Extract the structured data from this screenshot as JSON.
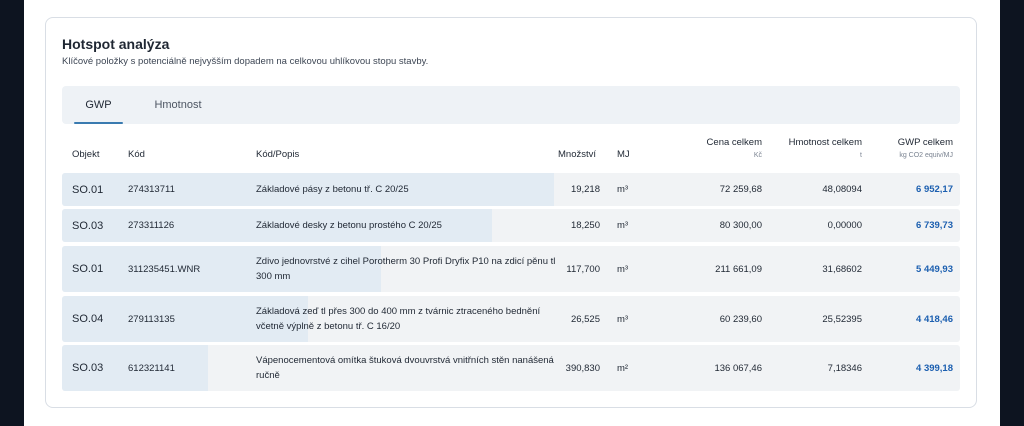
{
  "header": {
    "title": "Hotspot analýza",
    "subtitle": "Klíčové položky s potenciálně nejvyšším dopadem na celkovou uhlíkovou stopu stavby."
  },
  "tabs": [
    {
      "label": "GWP",
      "active": true
    },
    {
      "label": "Hmotnost",
      "active": false
    }
  ],
  "columns": {
    "objekt": "Objekt",
    "kod": "Kód",
    "popis": "Kód/Popis",
    "mnozstvi": "Množství",
    "mj": "MJ",
    "cena": "Cena celkem",
    "cena_unit": "Kč",
    "hmotnost": "Hmotnost celkem",
    "hmotnost_unit": "t",
    "gwp": "GWP celkem",
    "gwp_unit": "kg CO2 equiv/MJ"
  },
  "colors": {
    "accent": "#1c5fb0",
    "bar": "#e2ebf3"
  },
  "rows": [
    {
      "objekt": "SO.01",
      "kod": "274313711",
      "popis": "Základové pásy z betonu tř. C 20/25",
      "mnozstvi": "19,218",
      "mj": "m³",
      "cena": "72 259,68",
      "hmotnost": "48,08094",
      "gwp": "6 952,17",
      "share": 1.0
    },
    {
      "objekt": "SO.03",
      "kod": "273311126",
      "popis": "Základové desky z betonu prostého C 20/25",
      "mnozstvi": "18,250",
      "mj": "m³",
      "cena": "80 300,00",
      "hmotnost": "0,00000",
      "gwp": "6 739,73",
      "share": 0.82
    },
    {
      "objekt": "SO.01",
      "kod": "311235451.WNR",
      "popis": "Zdivo jednovrstvé z cihel Porotherm 30 Profi Dryfix P10 na zdicí pěnu tl 300 mm",
      "mnozstvi": "117,700",
      "mj": "m³",
      "cena": "211 661,09",
      "hmotnost": "31,68602",
      "gwp": "5 449,93",
      "share": 0.5
    },
    {
      "objekt": "SO.04",
      "kod": "279113135",
      "popis": "Základová zeď tl přes 300 do 400 mm z tvárnic ztraceného bednění včetně výplně z betonu tř. C 16/20",
      "mnozstvi": "26,525",
      "mj": "m³",
      "cena": "60 239,60",
      "hmotnost": "25,52395",
      "gwp": "4 418,46",
      "share": 0.29
    },
    {
      "objekt": "SO.03",
      "kod": "612321141",
      "popis": "Vápenocementová omítka štuková dvouvrstvá vnitřních stěn nanášená ručně",
      "mnozstvi": "390,830",
      "mj": "m²",
      "cena": "136 067,46",
      "hmotnost": "7,18346",
      "gwp": "4 399,18",
      "share": 0.0
    }
  ]
}
